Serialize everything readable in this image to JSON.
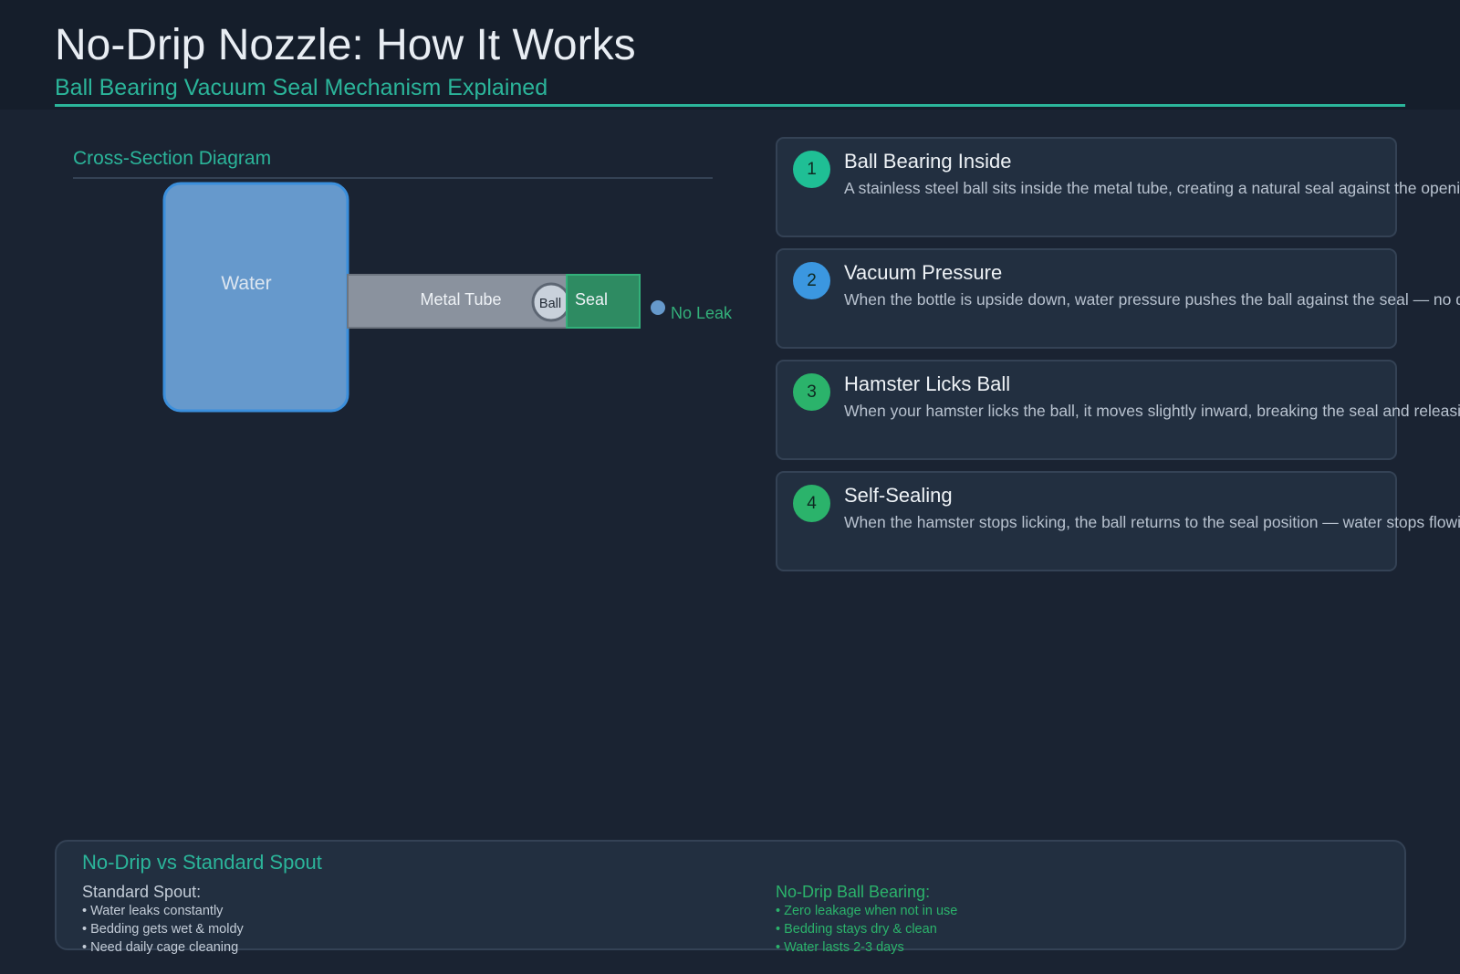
{
  "header": {
    "title": "No-Drip Nozzle: How It Works",
    "subtitle": "Ball Bearing Vacuum Seal Mechanism Explained"
  },
  "diagram": {
    "section_title": "Cross-Section Diagram",
    "labels": {
      "water": "Water",
      "tube": "Metal Tube",
      "ball": "Ball",
      "seal": "Seal",
      "no_leak": "No Leak"
    },
    "colors": {
      "water": "#6699cc",
      "water_border": "#3b8fdc",
      "tube": "#8a929e",
      "ball": "#c9d1db",
      "seal": "#2e8b62",
      "accent": "#2bb59a"
    }
  },
  "steps": [
    {
      "number": "1",
      "title": "Ball Bearing Inside",
      "description": "A stainless steel ball sits inside the metal tube, creating a natural seal against the opening.",
      "color": "#1fbf95"
    },
    {
      "number": "2",
      "title": "Vacuum Pressure",
      "description": "When the bottle is upside down, water pressure pushes the ball against the seal — no drips escape.",
      "color": "#3b97e0"
    },
    {
      "number": "3",
      "title": "Hamster Licks Ball",
      "description": "When your hamster licks the ball, it moves slightly inward, breaking the seal and releasing water.",
      "color": "#2bb36b"
    },
    {
      "number": "4",
      "title": "Self-Sealing",
      "description": "When the hamster stops licking, the ball returns to the seal position — water stops flowing instantly.",
      "color": "#2bb36b"
    }
  ],
  "comparison": {
    "title": "No-Drip vs Standard Spout",
    "standard": {
      "heading": "Standard Spout:",
      "items": [
        "• Water leaks constantly",
        "• Bedding gets wet & moldy",
        "• Need daily cage cleaning"
      ]
    },
    "nodrip": {
      "heading": "No-Drip Ball Bearing:",
      "items": [
        "• Zero leakage when not in use",
        "• Bedding stays dry & clean",
        "• Water lasts 2-3 days"
      ]
    }
  }
}
